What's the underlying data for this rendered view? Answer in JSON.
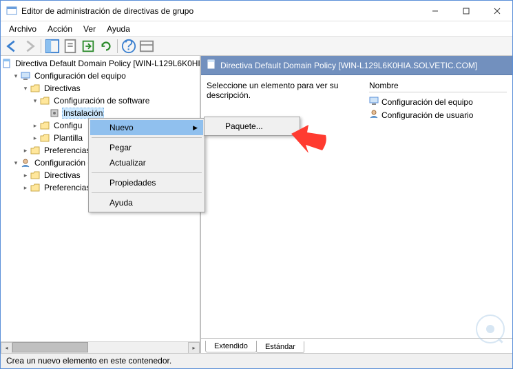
{
  "window": {
    "title": "Editor de administración de directivas de grupo"
  },
  "menu": {
    "file": "Archivo",
    "action": "Acción",
    "view": "Ver",
    "help": "Ayuda"
  },
  "tree": {
    "root": "Directiva Default Domain Policy [WIN-L129L6K0HI",
    "computer_config": "Configuración del equipo",
    "policies": "Directivas",
    "software_config": "Configuración de software",
    "software_install": "Instalación",
    "configui": "Configu",
    "templates": "Plantilla",
    "preferences": "Preferencias",
    "user_config_parent": "Configuración d",
    "policies_user": "Directivas",
    "preferences_user": "Preferencias"
  },
  "context_menu": {
    "new": "Nuevo",
    "paste": "Pegar",
    "refresh": "Actualizar",
    "properties": "Propiedades",
    "help": "Ayuda",
    "package": "Paquete..."
  },
  "details": {
    "header": "Directiva Default Domain Policy [WIN-L129L6K0HIA.SOLVETIC.COM]",
    "description": "Seleccione un elemento para ver su descripción.",
    "col_name": "Nombre",
    "item_computer": "Configuración del equipo",
    "item_user": "Configuración de usuario"
  },
  "tabs": {
    "extended": "Extendido",
    "standard": "Estándar"
  },
  "statusbar": "Crea un nuevo elemento en este contenedor."
}
